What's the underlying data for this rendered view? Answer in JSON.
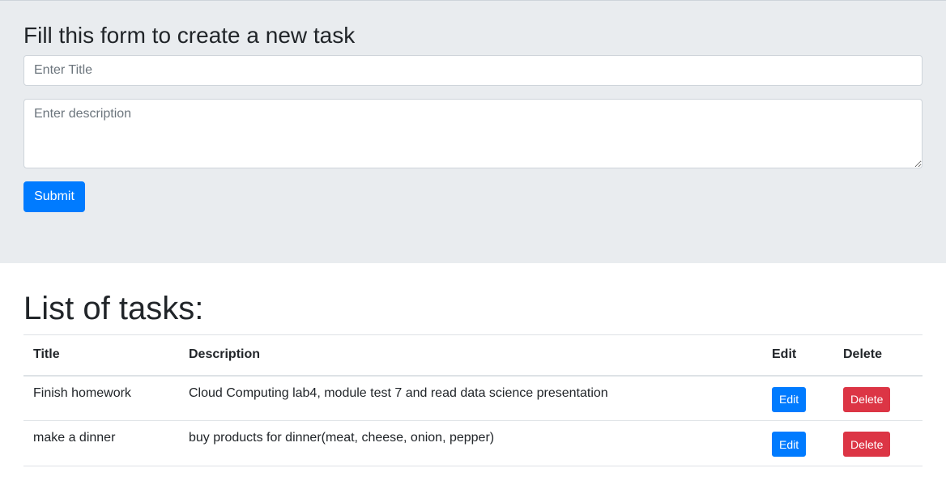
{
  "form": {
    "heading": "Fill this form to create a new task",
    "title_placeholder": "Enter Title",
    "title_value": "",
    "description_placeholder": "Enter description",
    "description_value": "",
    "submit_label": "Submit"
  },
  "list": {
    "heading": "List of tasks:",
    "columns": [
      "Title",
      "Description",
      "Edit",
      "Delete"
    ],
    "rows": [
      {
        "title": "Finish homework",
        "description": "Cloud Computing lab4, module test 7 and read data science presentation",
        "edit_label": "Edit",
        "delete_label": "Delete"
      },
      {
        "title": "make a dinner",
        "description": "buy products for dinner(meat, cheese, onion, pepper)",
        "edit_label": "Edit",
        "delete_label": "Delete"
      }
    ]
  },
  "colors": {
    "jumbotron_bg": "#e9ecef",
    "primary": "#007bff",
    "danger": "#dc3545"
  }
}
